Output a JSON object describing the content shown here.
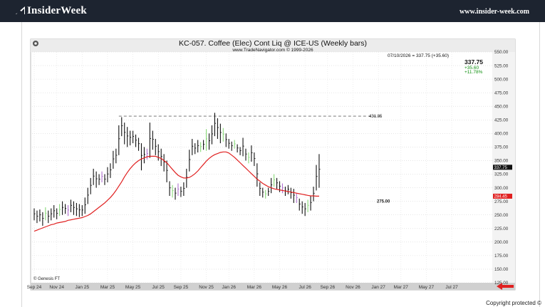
{
  "header": {
    "site_name": "InsiderWeek",
    "site_url": "www.insider-week.com",
    "colors": {
      "bar": "#1d2430",
      "text": "#ffffff"
    }
  },
  "footer": {
    "copyright": "Copyright protected ©"
  },
  "chart_data": {
    "type": "bar",
    "subtype": "weekly-high-low-bars",
    "title": "KC-057.  Coffee (Elec) Cont Liq @ ICE-US  (Weekly bars)",
    "subtitle": "www.TradeNavigator.com © 1999-2026",
    "date_readout": "07/10/2026 = 337.75 (+35.60)",
    "last_price": "337.75",
    "change": "+35.60",
    "change_pct": "+11.78%",
    "price_tag": "337.75",
    "ma_tag": "284.45",
    "resistance_label": "431.85",
    "support_label": "275.00",
    "resistance_level": 431.85,
    "support_level": 275.0,
    "watermark": "© Genesis FT",
    "ylim": [
      125,
      550
    ],
    "yticks": [
      "550.00",
      "525.00",
      "500.00",
      "475.00",
      "450.00",
      "425.00",
      "400.00",
      "375.00",
      "350.00",
      "325.00",
      "300.00",
      "275.00",
      "250.00",
      "225.00",
      "200.00",
      "175.00",
      "150.00",
      "125.00"
    ],
    "xlabels": [
      "Sep 24",
      "Nov 24",
      "Jan 25",
      "Mar 25",
      "May 25",
      "Jul 25",
      "Sep 25",
      "Nov 25",
      "Jan 26",
      "Mar 26",
      "May 26",
      "Jul 26",
      "Sep 26",
      "Nov 26",
      "Jan 27",
      "Mar 27",
      "May 27",
      "Jul 27"
    ],
    "xlabel_weeks": [
      0,
      8,
      17,
      26,
      35,
      44,
      52,
      61,
      69,
      78,
      87,
      96,
      104,
      113,
      122,
      130,
      139,
      148
    ],
    "color_legend": {
      "down": "#111111",
      "green": "#88d878",
      "purple": "#b070d0",
      "ma": "#e02020",
      "tag_ma": "#e02020",
      "tag_price": "#111111",
      "change": "#109010"
    },
    "bars": [
      {
        "h": 262,
        "l": 240,
        "c": "k"
      },
      {
        "h": 258,
        "l": 235,
        "c": "k"
      },
      {
        "h": 260,
        "l": 238,
        "c": "k"
      },
      {
        "h": 255,
        "l": 230,
        "c": "k"
      },
      {
        "h": 264,
        "l": 240,
        "c": "g"
      },
      {
        "h": 258,
        "l": 235,
        "c": "k"
      },
      {
        "h": 262,
        "l": 240,
        "c": "k"
      },
      {
        "h": 268,
        "l": 245,
        "c": "k"
      },
      {
        "h": 262,
        "l": 242,
        "c": "k"
      },
      {
        "h": 270,
        "l": 248,
        "c": "g"
      },
      {
        "h": 275,
        "l": 250,
        "c": "k"
      },
      {
        "h": 270,
        "l": 252,
        "c": "k"
      },
      {
        "h": 268,
        "l": 248,
        "c": "p"
      },
      {
        "h": 278,
        "l": 255,
        "c": "k"
      },
      {
        "h": 275,
        "l": 250,
        "c": "k"
      },
      {
        "h": 272,
        "l": 248,
        "c": "k"
      },
      {
        "h": 270,
        "l": 246,
        "c": "k"
      },
      {
        "h": 268,
        "l": 248,
        "c": "k"
      },
      {
        "h": 282,
        "l": 252,
        "c": "k"
      },
      {
        "h": 300,
        "l": 270,
        "c": "k"
      },
      {
        "h": 318,
        "l": 288,
        "c": "k"
      },
      {
        "h": 335,
        "l": 305,
        "c": "k"
      },
      {
        "h": 330,
        "l": 300,
        "c": "k"
      },
      {
        "h": 325,
        "l": 305,
        "c": "k"
      },
      {
        "h": 330,
        "l": 310,
        "c": "p"
      },
      {
        "h": 325,
        "l": 305,
        "c": "k"
      },
      {
        "h": 338,
        "l": 310,
        "c": "k"
      },
      {
        "h": 345,
        "l": 318,
        "c": "k"
      },
      {
        "h": 368,
        "l": 335,
        "c": "k"
      },
      {
        "h": 372,
        "l": 345,
        "c": "k"
      },
      {
        "h": 415,
        "l": 360,
        "c": "k"
      },
      {
        "h": 430,
        "l": 395,
        "c": "k"
      },
      {
        "h": 420,
        "l": 380,
        "c": "k"
      },
      {
        "h": 412,
        "l": 375,
        "c": "k"
      },
      {
        "h": 405,
        "l": 378,
        "c": "k"
      },
      {
        "h": 405,
        "l": 382,
        "c": "k"
      },
      {
        "h": 398,
        "l": 375,
        "c": "k"
      },
      {
        "h": 392,
        "l": 368,
        "c": "k"
      },
      {
        "h": 382,
        "l": 332,
        "c": "k"
      },
      {
        "h": 375,
        "l": 345,
        "c": "k"
      },
      {
        "h": 372,
        "l": 352,
        "c": "p"
      },
      {
        "h": 420,
        "l": 355,
        "c": "k"
      },
      {
        "h": 405,
        "l": 370,
        "c": "k"
      },
      {
        "h": 390,
        "l": 360,
        "c": "k"
      },
      {
        "h": 380,
        "l": 350,
        "c": "k"
      },
      {
        "h": 372,
        "l": 340,
        "c": "k"
      },
      {
        "h": 362,
        "l": 330,
        "c": "k"
      },
      {
        "h": 350,
        "l": 310,
        "c": "k"
      },
      {
        "h": 312,
        "l": 285,
        "c": "k"
      },
      {
        "h": 305,
        "l": 282,
        "c": "g"
      },
      {
        "h": 300,
        "l": 278,
        "c": "k"
      },
      {
        "h": 308,
        "l": 285,
        "c": "p"
      },
      {
        "h": 302,
        "l": 283,
        "c": "k"
      },
      {
        "h": 310,
        "l": 285,
        "c": "k"
      },
      {
        "h": 335,
        "l": 300,
        "c": "k"
      },
      {
        "h": 370,
        "l": 330,
        "c": "k"
      },
      {
        "h": 390,
        "l": 360,
        "c": "k"
      },
      {
        "h": 382,
        "l": 362,
        "c": "k"
      },
      {
        "h": 388,
        "l": 365,
        "c": "k"
      },
      {
        "h": 384,
        "l": 366,
        "c": "g"
      },
      {
        "h": 388,
        "l": 370,
        "c": "k"
      },
      {
        "h": 408,
        "l": 368,
        "c": "g"
      },
      {
        "h": 400,
        "l": 370,
        "c": "k"
      },
      {
        "h": 415,
        "l": 380,
        "c": "k"
      },
      {
        "h": 438,
        "l": 395,
        "c": "k"
      },
      {
        "h": 428,
        "l": 390,
        "c": "k"
      },
      {
        "h": 418,
        "l": 382,
        "c": "k"
      },
      {
        "h": 410,
        "l": 385,
        "c": "g"
      },
      {
        "h": 400,
        "l": 375,
        "c": "k"
      },
      {
        "h": 390,
        "l": 372,
        "c": "k"
      },
      {
        "h": 385,
        "l": 368,
        "c": "k"
      },
      {
        "h": 388,
        "l": 372,
        "c": "g"
      },
      {
        "h": 380,
        "l": 365,
        "c": "k"
      },
      {
        "h": 375,
        "l": 360,
        "c": "k"
      },
      {
        "h": 392,
        "l": 358,
        "c": "k"
      },
      {
        "h": 372,
        "l": 350,
        "c": "k"
      },
      {
        "h": 365,
        "l": 345,
        "c": "g"
      },
      {
        "h": 378,
        "l": 348,
        "c": "k"
      },
      {
        "h": 365,
        "l": 340,
        "c": "k"
      },
      {
        "h": 345,
        "l": 302,
        "c": "k"
      },
      {
        "h": 310,
        "l": 285,
        "c": "k"
      },
      {
        "h": 300,
        "l": 282,
        "c": "k"
      },
      {
        "h": 296,
        "l": 280,
        "c": "g"
      },
      {
        "h": 300,
        "l": 285,
        "c": "k"
      },
      {
        "h": 318,
        "l": 290,
        "c": "k"
      },
      {
        "h": 325,
        "l": 302,
        "c": "g"
      },
      {
        "h": 318,
        "l": 298,
        "c": "k"
      },
      {
        "h": 312,
        "l": 292,
        "c": "k"
      },
      {
        "h": 308,
        "l": 290,
        "c": "p"
      },
      {
        "h": 302,
        "l": 285,
        "c": "k"
      },
      {
        "h": 305,
        "l": 288,
        "c": "k"
      },
      {
        "h": 300,
        "l": 280,
        "c": "k"
      },
      {
        "h": 298,
        "l": 272,
        "c": "k"
      },
      {
        "h": 290,
        "l": 272,
        "c": "p"
      },
      {
        "h": 280,
        "l": 258,
        "c": "k"
      },
      {
        "h": 275,
        "l": 252,
        "c": "k"
      },
      {
        "h": 272,
        "l": 248,
        "c": "k"
      },
      {
        "h": 278,
        "l": 255,
        "c": "g"
      },
      {
        "h": 285,
        "l": 258,
        "c": "k"
      },
      {
        "h": 302,
        "l": 275,
        "c": "k"
      },
      {
        "h": 342,
        "l": 295,
        "c": "k"
      },
      {
        "h": 362,
        "l": 300,
        "c": "k"
      }
    ],
    "ma": [
      220,
      222,
      224,
      226,
      228,
      230,
      232,
      233,
      235,
      236,
      237,
      238,
      240,
      241,
      242,
      243,
      244,
      245,
      247,
      249,
      252,
      256,
      260,
      264,
      268,
      272,
      277,
      282,
      288,
      295,
      303,
      311,
      320,
      328,
      335,
      341,
      346,
      350,
      353,
      355,
      357,
      358,
      358,
      358,
      356,
      354,
      350,
      346,
      340,
      334,
      328,
      323,
      320,
      318,
      318,
      319,
      322,
      326,
      331,
      337,
      343,
      349,
      354,
      358,
      361,
      363,
      365,
      366,
      366,
      364,
      360,
      356,
      351,
      346,
      341,
      336,
      331,
      326,
      321,
      316,
      312,
      308,
      305,
      302,
      300,
      298,
      297,
      296,
      295,
      294,
      293,
      292,
      291,
      290,
      289,
      288,
      287,
      286,
      285,
      285,
      284.45,
      284.45
    ]
  }
}
